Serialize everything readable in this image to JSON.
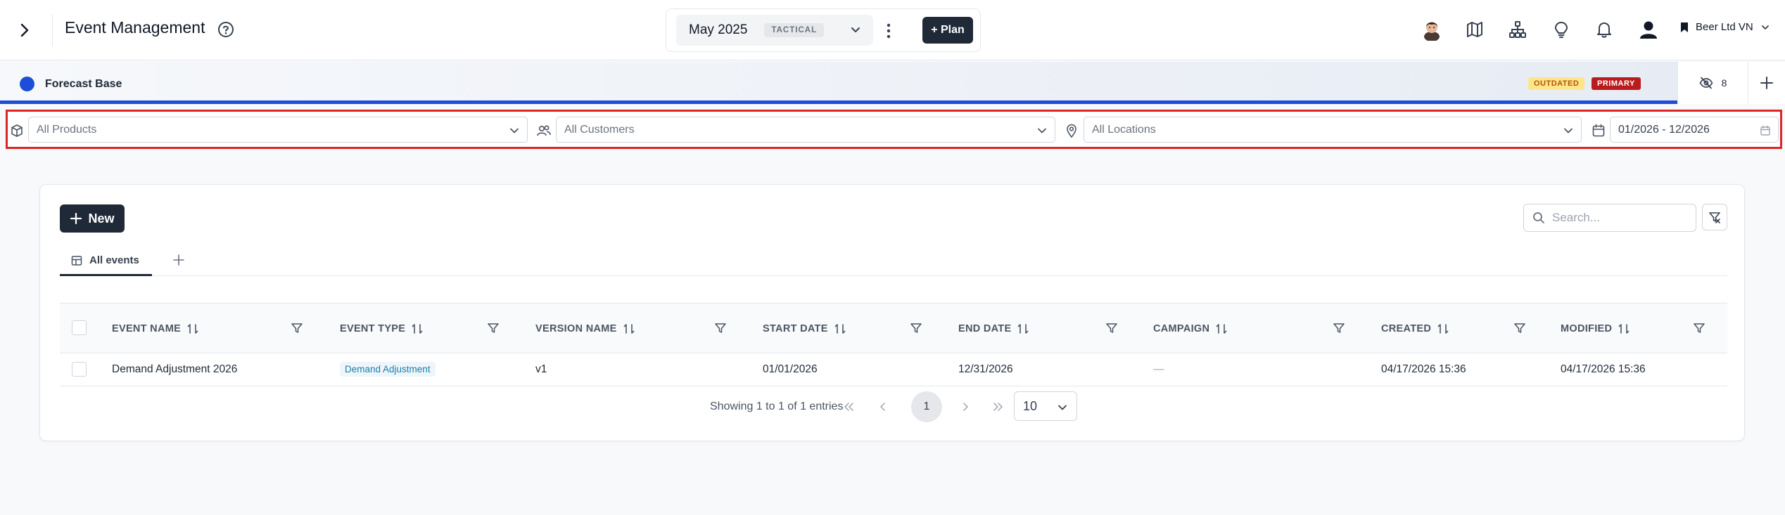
{
  "header": {
    "title": "Event Management",
    "period": "May 2025",
    "period_badge": "TACTICAL",
    "plan_button": "+ Plan",
    "company": "Beer Ltd VN"
  },
  "version_bar": {
    "name": "Forecast Base",
    "badge_outdated": "OUTDATED",
    "badge_primary": "PRIMARY",
    "hidden_count": "8",
    "accent_color": "#1d4ed8"
  },
  "filters": {
    "products": "All Products",
    "customers": "All Customers",
    "locations": "All Locations",
    "date_range": "01/2026 - 12/2026"
  },
  "toolbar": {
    "new_label": "New",
    "search_placeholder": "Search..."
  },
  "tabs": [
    {
      "label": "All events"
    }
  ],
  "table": {
    "columns": [
      "EVENT NAME",
      "EVENT TYPE",
      "VERSION NAME",
      "START DATE",
      "END DATE",
      "CAMPAIGN",
      "CREATED",
      "MODIFIED"
    ],
    "rows": [
      {
        "event_name": "Demand Adjustment 2026",
        "event_type": "Demand Adjustment",
        "version_name": "v1",
        "start_date": "01/01/2026",
        "end_date": "12/31/2026",
        "campaign": "—",
        "created": "04/17/2026 15:36",
        "modified": "04/17/2026 15:36"
      }
    ]
  },
  "pagination": {
    "showing": "Showing 1 to 1 of 1 entries",
    "current_page": "1",
    "page_size": "10"
  }
}
